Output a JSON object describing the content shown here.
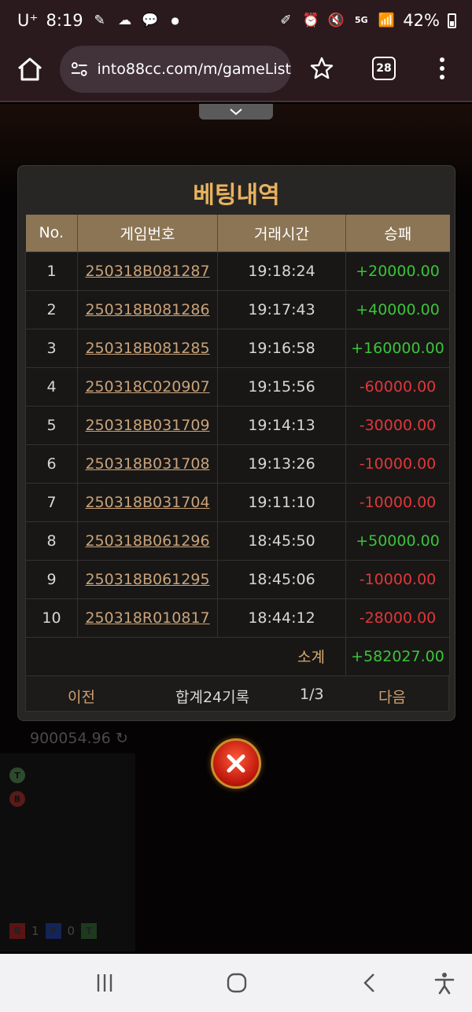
{
  "status_bar": {
    "carrier": "U⁺",
    "time": "8:19",
    "left_icons": [
      "brush-icon",
      "cloud-icon",
      "talk-icon",
      "dot-icon"
    ],
    "right_icons": [
      "pen-off-icon",
      "alarm-icon",
      "mute-icon",
      "5g-icon",
      "signal-icon"
    ],
    "battery": "42%"
  },
  "browser": {
    "url": "into88cc.com/m/gameList",
    "tab_count": "28"
  },
  "modal": {
    "title": "베팅내역",
    "columns": [
      "No.",
      "게임번호",
      "거래시간",
      "승패"
    ],
    "rows": [
      {
        "no": "1",
        "game_id": "250318B081287",
        "time": "19:18:24",
        "result": "+20000.00",
        "status": "pos"
      },
      {
        "no": "2",
        "game_id": "250318B081286",
        "time": "19:17:43",
        "result": "+40000.00",
        "status": "pos"
      },
      {
        "no": "3",
        "game_id": "250318B081285",
        "time": "19:16:58",
        "result": "+160000.00",
        "status": "pos"
      },
      {
        "no": "4",
        "game_id": "250318C020907",
        "time": "19:15:56",
        "result": "-60000.00",
        "status": "neg"
      },
      {
        "no": "5",
        "game_id": "250318B031709",
        "time": "19:14:13",
        "result": "-30000.00",
        "status": "neg"
      },
      {
        "no": "6",
        "game_id": "250318B031708",
        "time": "19:13:26",
        "result": "-10000.00",
        "status": "neg"
      },
      {
        "no": "7",
        "game_id": "250318B031704",
        "time": "19:11:10",
        "result": "-10000.00",
        "status": "neg"
      },
      {
        "no": "8",
        "game_id": "250318B061296",
        "time": "18:45:50",
        "result": "+50000.00",
        "status": "pos"
      },
      {
        "no": "9",
        "game_id": "250318B061295",
        "time": "18:45:06",
        "result": "-10000.00",
        "status": "neg"
      },
      {
        "no": "10",
        "game_id": "250318R010817",
        "time": "18:44:12",
        "result": "-28000.00",
        "status": "neg"
      }
    ],
    "subtotal_label": "소계",
    "subtotal_value": "+582027.00",
    "pager": {
      "prev": "이전",
      "total": "합계24기록",
      "page": "1/3",
      "next": "다음"
    }
  },
  "background": {
    "balance": "900054.96",
    "road_labels": [
      "T",
      "B"
    ],
    "tally": [
      {
        "label": "B",
        "count": "1"
      },
      {
        "label": "P",
        "count": "0"
      },
      {
        "label": "T",
        "count": ""
      }
    ]
  },
  "colors": {
    "accent_gold": "#e8b25e",
    "header_bg": "#8c7555",
    "win_green": "#3cc33c",
    "loss_red": "#e0363b",
    "link_tan": "#c9a27a"
  }
}
